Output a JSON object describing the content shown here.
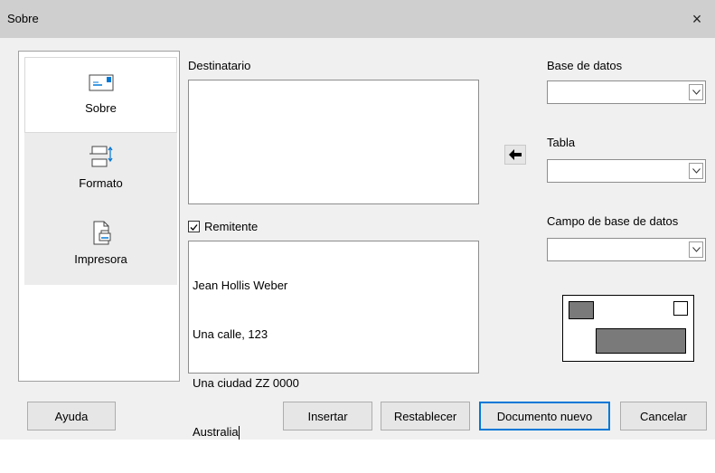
{
  "window": {
    "title": "Sobre",
    "close_symbol": "×"
  },
  "nav": {
    "items": [
      {
        "label": "Sobre",
        "icon": "envelope-icon",
        "active": true
      },
      {
        "label": "Formato",
        "icon": "format-icon",
        "active": false
      },
      {
        "label": "Impresora",
        "icon": "printer-icon",
        "active": false
      }
    ]
  },
  "recipient": {
    "label": "Destinatario",
    "value": ""
  },
  "sender": {
    "label": "Remitente",
    "checked": true,
    "lines": [
      "Jean Hollis Weber",
      "Una calle, 123",
      "Una ciudad ZZ 0000",
      "Australia"
    ]
  },
  "database": {
    "label": "Base de datos",
    "value": ""
  },
  "table": {
    "label": "Tabla",
    "value": ""
  },
  "field": {
    "label": "Campo de base de datos",
    "value": ""
  },
  "buttons": {
    "help": "Ayuda",
    "insert": "Insertar",
    "reset": "Restablecer",
    "new_doc": "Documento nuevo",
    "cancel": "Cancelar"
  }
}
